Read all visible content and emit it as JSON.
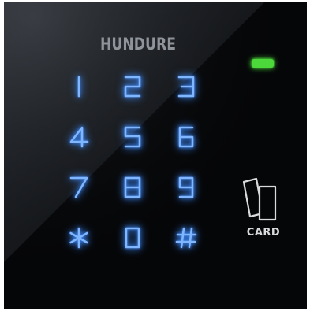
{
  "brand": {
    "name": "HUNDURE"
  },
  "keypad": {
    "keys": [
      "1",
      "2",
      "3",
      "4",
      "5",
      "6",
      "7",
      "8",
      "9",
      "*",
      "0",
      "#"
    ]
  },
  "card_reader": {
    "label": "CARD",
    "icon": "rfid-card-icon"
  },
  "status_led": {
    "icon": "status-led-icon",
    "color": "#4cd83a"
  },
  "colors": {
    "panel": "#050608",
    "key_glow": "#3d8bff",
    "key_core": "#7fb6ff",
    "brand_text": "#8f949a",
    "card_text": "#d8dadc"
  }
}
